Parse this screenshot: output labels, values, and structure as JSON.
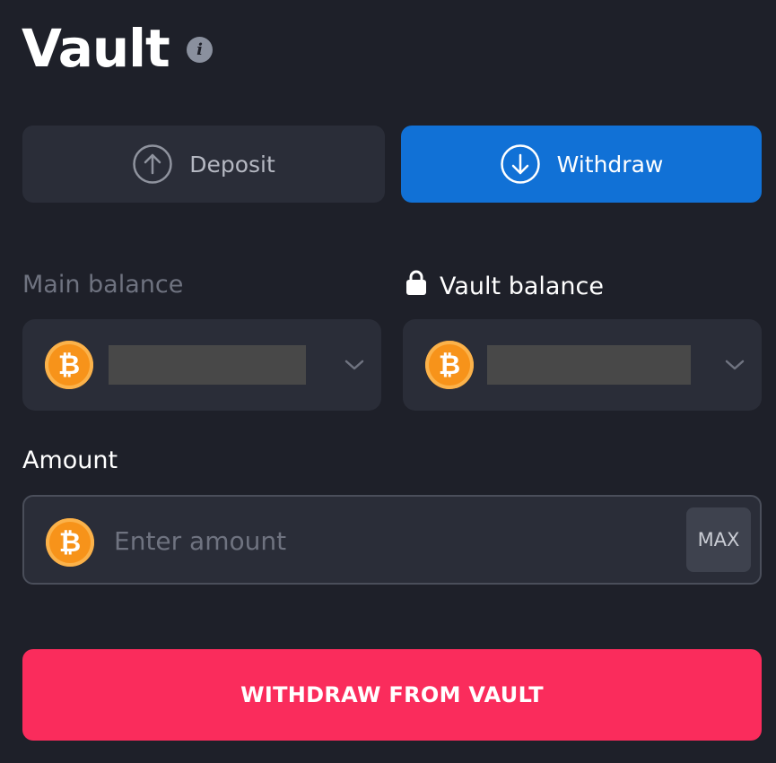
{
  "header": {
    "title": "Vault",
    "info_icon": "info-icon",
    "info_glyph": "i"
  },
  "tabs": [
    {
      "label": "Deposit",
      "icon": "arrow-up-circle-icon",
      "active": false
    },
    {
      "label": "Withdraw",
      "icon": "arrow-down-circle-icon",
      "active": true
    }
  ],
  "balances": {
    "main": {
      "label": "Main balance",
      "currency_icon": "bitcoin-icon",
      "currency_glyph": "₿"
    },
    "vault": {
      "label": "Vault balance",
      "lock_icon": "lock-icon",
      "currency_icon": "bitcoin-icon",
      "currency_glyph": "₿"
    }
  },
  "amount": {
    "label": "Amount",
    "placeholder": "Enter amount",
    "value": "",
    "currency_glyph": "₿",
    "max_label": "MAX"
  },
  "submit": {
    "label": "WITHDRAW FROM VAULT"
  },
  "colors": {
    "background": "#1e2029",
    "panel": "#2a2d38",
    "active_tab": "#1171d6",
    "submit": "#fa2c5c",
    "bitcoin": "#f7931a"
  }
}
